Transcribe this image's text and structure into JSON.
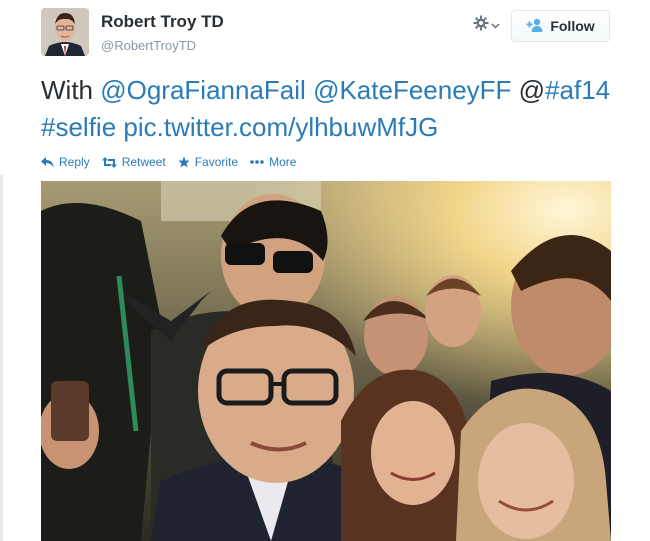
{
  "profile": {
    "name": "Robert Troy TD",
    "handle": "@RobertTroyTD"
  },
  "header": {
    "follow_label": "Follow",
    "gear_icon": "gear-icon",
    "follow_icon": "add-user-icon"
  },
  "tweet": {
    "prefix": "With ",
    "mention1": "@OgraFiannaFail",
    "mention2": "@KateFeeneyFF",
    "at_sign": "@",
    "hashtag1": "#af14",
    "hashtag2": "#selfie",
    "link": "pic.twitter.com/ylhbuwMfJG"
  },
  "actions": {
    "reply": "Reply",
    "retweet": "Retweet",
    "favorite": "Favorite",
    "more": "More"
  },
  "colors": {
    "link": "#2b7bb9",
    "text": "#292f33",
    "muted": "#8899a6"
  }
}
